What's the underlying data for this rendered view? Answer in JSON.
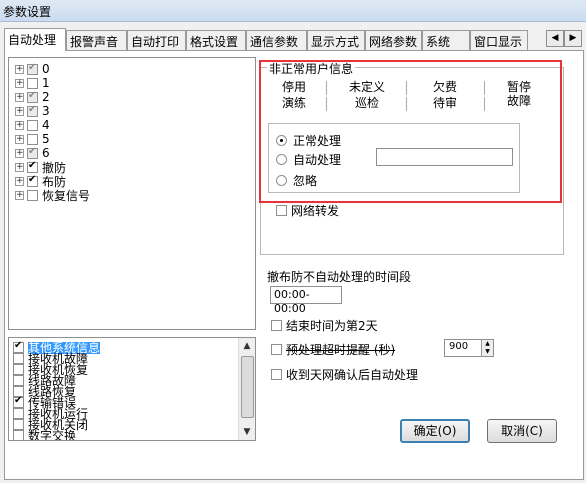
{
  "window": {
    "title": "参数设置"
  },
  "tabs": [
    "自动处理",
    "报警声音",
    "自动打印",
    "格式设置",
    "通信参数",
    "显示方式",
    "网络参数",
    "系统",
    "窗口显示"
  ],
  "tab_scroll": {
    "left": "◀",
    "right": "▶"
  },
  "tree": {
    "items": [
      {
        "label": "0",
        "checked": true,
        "gray": true
      },
      {
        "label": "1",
        "checked": false,
        "gray": false
      },
      {
        "label": "2",
        "checked": true,
        "gray": true
      },
      {
        "label": "3",
        "checked": true,
        "gray": true
      },
      {
        "label": "4",
        "checked": false,
        "gray": false
      },
      {
        "label": "5",
        "checked": false,
        "gray": false
      },
      {
        "label": "6",
        "checked": true,
        "gray": true
      },
      {
        "label": "撤防",
        "checked": true,
        "gray": false
      },
      {
        "label": "布防",
        "checked": true,
        "gray": false
      },
      {
        "label": "恢复信号",
        "checked": false,
        "gray": false
      }
    ],
    "expander": "+"
  },
  "list2": {
    "items": [
      {
        "label": "其他系统信息",
        "checked": true,
        "selected": true
      },
      {
        "label": "接收机故障",
        "checked": false,
        "selected": false
      },
      {
        "label": "接收机恢复",
        "checked": false,
        "selected": false
      },
      {
        "label": "线路故障",
        "checked": false,
        "selected": false
      },
      {
        "label": "线路恢复",
        "checked": false,
        "selected": false
      },
      {
        "label": "传输错误",
        "checked": true,
        "selected": false
      },
      {
        "label": "接收机运行",
        "checked": false,
        "selected": false
      },
      {
        "label": "接收机关闭",
        "checked": false,
        "selected": false
      },
      {
        "label": "数字交换",
        "checked": false,
        "selected": false
      }
    ],
    "scroll_up": "▲",
    "scroll_down": "▼"
  },
  "group": {
    "legend": "非正常用户信息",
    "subtabs_row1": [
      "停用",
      "未定义",
      "欠费",
      "暂停"
    ],
    "subtabs_row2": [
      "演练",
      "巡检",
      "待审",
      "故障"
    ],
    "radios": [
      {
        "label": "正常处理",
        "selected": true
      },
      {
        "label": "自动处理",
        "selected": false
      },
      {
        "label": "忽略",
        "selected": false
      }
    ],
    "auto_value": "",
    "network_forward_label": "网络转发"
  },
  "time_section": {
    "label": "撤布防不自动处理的时间段",
    "value": "00:00-00:00"
  },
  "options": {
    "end_next_day": "结束时间为第2天",
    "timeout_label": "预处理超时提醒 (秒)",
    "timeout_value": "900",
    "network_confirm": "收到天网确认后自动处理"
  },
  "buttons": {
    "ok": "确定(O)",
    "cancel": "取消(C)"
  },
  "colors": {
    "highlight_border": "#e8333a",
    "selection": "#3399ff"
  }
}
